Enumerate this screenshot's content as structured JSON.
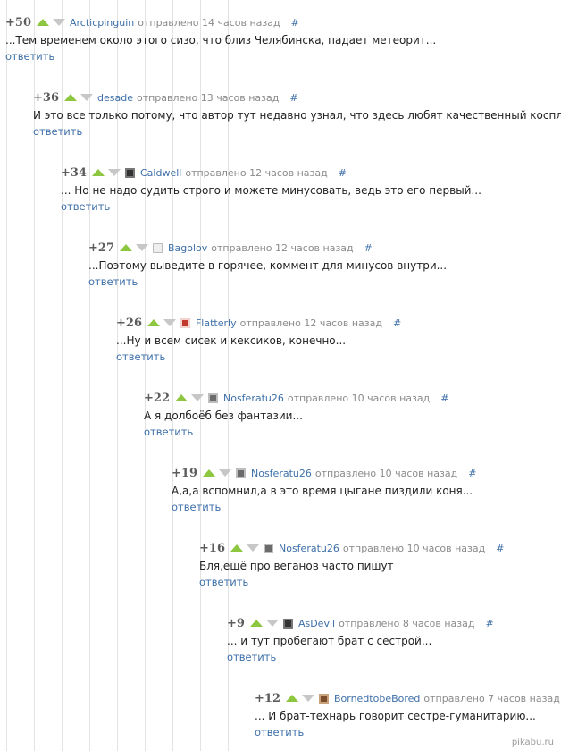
{
  "reply_label": "ответить",
  "hash_label": "#",
  "comments": [
    {
      "rating": "+50",
      "author": "Arcticpinguin",
      "meta": "отправлено 14 часов назад",
      "text": "...Тем временем около этого сизо, что близ Челябинска, падает метеорит...",
      "avatar": ""
    },
    {
      "rating": "+36",
      "author": "desade",
      "meta": "отправлено 13 часов назад",
      "text": "И это все только потому, что автор тут недавно узнал, что здесь любят качественный косплей.",
      "avatar": ""
    },
    {
      "rating": "+34",
      "author": "Caldwell",
      "meta": "отправлено 12 часов назад",
      "text": "... Но не надо судить строго и можете минусовать, ведь это его первый...",
      "avatar": "dark-avatar"
    },
    {
      "rating": "+27",
      "author": "Bagolov",
      "meta": "отправлено 12 часов назад",
      "text": "...Поэтому выведите в горячее, коммент для минусов внутри...",
      "avatar": "light-avatar"
    },
    {
      "rating": "+26",
      "author": "Flatterly",
      "meta": "отправлено 12 часов назад",
      "text": "...Ну и всем сисек и кексиков, конечно...",
      "avatar": "red-avatar"
    },
    {
      "rating": "+22",
      "author": "Nosferatu26",
      "meta": "отправлено 10 часов назад",
      "text": "А я долбоёб без фантазии...",
      "avatar": "grey-avatar"
    },
    {
      "rating": "+19",
      "author": "Nosferatu26",
      "meta": "отправлено 10 часов назад",
      "text": "А,а,а вспомнил,а в это время цыгане пиздили коня...",
      "avatar": "grey-avatar"
    },
    {
      "rating": "+16",
      "author": "Nosferatu26",
      "meta": "отправлено 10 часов назад",
      "text": "Бля,ещё про веганов часто пишут",
      "avatar": "grey-avatar"
    },
    {
      "rating": "+9",
      "author": "AsDevil",
      "meta": "отправлено 8 часов назад",
      "text": "... и тут пробегают брат с сестрой...",
      "avatar": "dark-avatar"
    },
    {
      "rating": "+12",
      "author": "BornedtobeBored",
      "meta": "отправлено 7 часов назад",
      "text": "... И брат-технарь говорит сестре-гуманитарию...",
      "avatar": "brown-avatar"
    }
  ],
  "watermark": "pikabu.ru",
  "colors": {
    "accent": "#3d6fa8",
    "upvote": "#8dc63f",
    "downvote": "#c7c7c7"
  }
}
